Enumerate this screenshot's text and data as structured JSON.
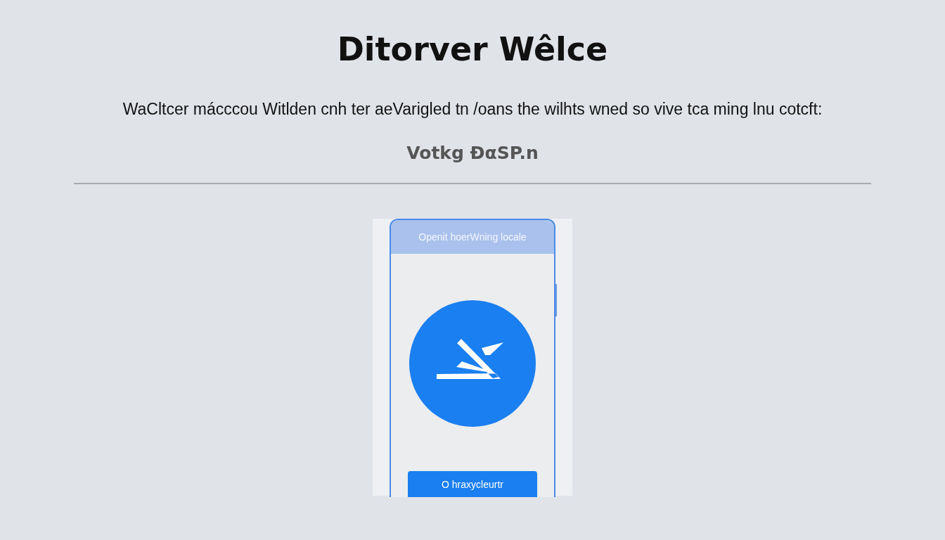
{
  "title": "Ditorver Wêlce",
  "description": "WaCltcer mácccou Witlden cnh ter aeVarigled tn /oans the wilhts wned so vive tca ming lnu cotcft:",
  "subtitle": "Votkg ĐαSP.n",
  "card": {
    "header": "Openit hoerWning locale",
    "button": "O hraxycleurtr"
  }
}
